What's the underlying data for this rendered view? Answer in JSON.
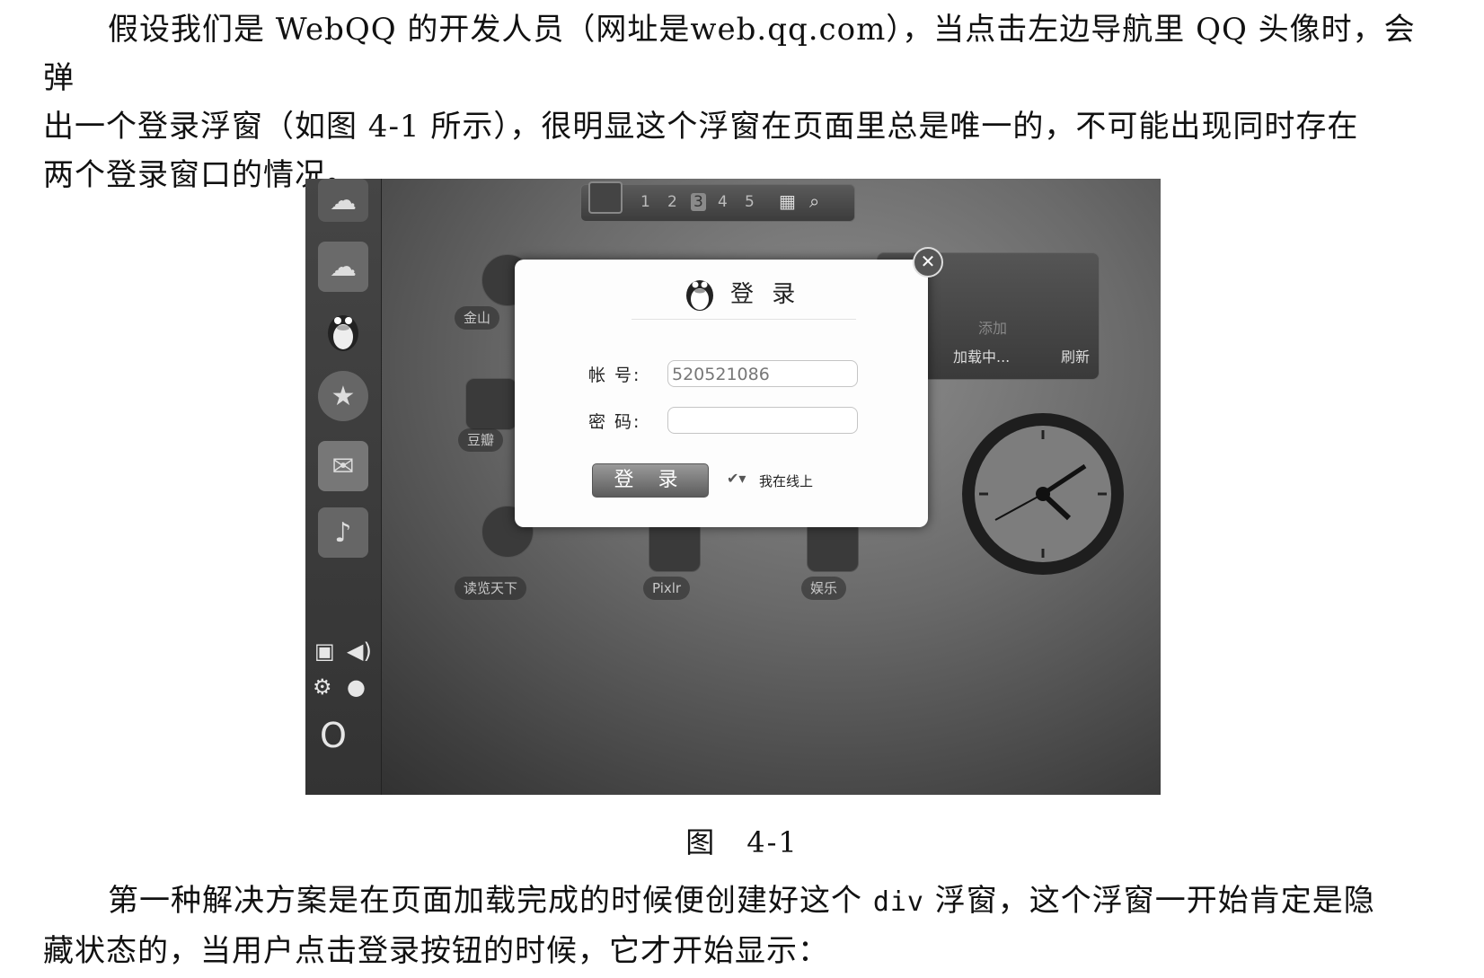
{
  "paragraph1": {
    "line1": "假设我们是 WebQQ 的开发人员（网址是web.qq.com），当点击左边导航里 QQ 头像时，会弹",
    "line2": "出一个登录浮窗（如图 4-1 所示），很明显这个浮窗在页面里总是唯一的，不可能出现同时存在",
    "line3": "两个登录窗口的情况。"
  },
  "figure": {
    "pager": [
      "1",
      "2",
      "3",
      "4",
      "5"
    ],
    "apps": {
      "app1": "金山",
      "app2": "豆瓣",
      "app3": "读览天下",
      "app4": "Pixlr",
      "app5": "娱乐"
    },
    "widget": {
      "add": "添加",
      "loading": "加载中...",
      "refresh": "刷新"
    },
    "dialog": {
      "title": "登 录",
      "account_label": "帐  号:",
      "account_value": "520521086",
      "password_label": "密  码:",
      "password_value": "",
      "login_button": "登 录",
      "status": "我在线上"
    }
  },
  "caption": "图　4-1",
  "paragraph2": {
    "line1_a": "第一种解决方案是在页面加载完成的时候便创建好这个 ",
    "line1_code": "div",
    "line1_b": " 浮窗，这个浮窗一开始肯定是隐",
    "line2": "藏状态的，当用户点击登录按钮的时候，它才开始显示："
  }
}
